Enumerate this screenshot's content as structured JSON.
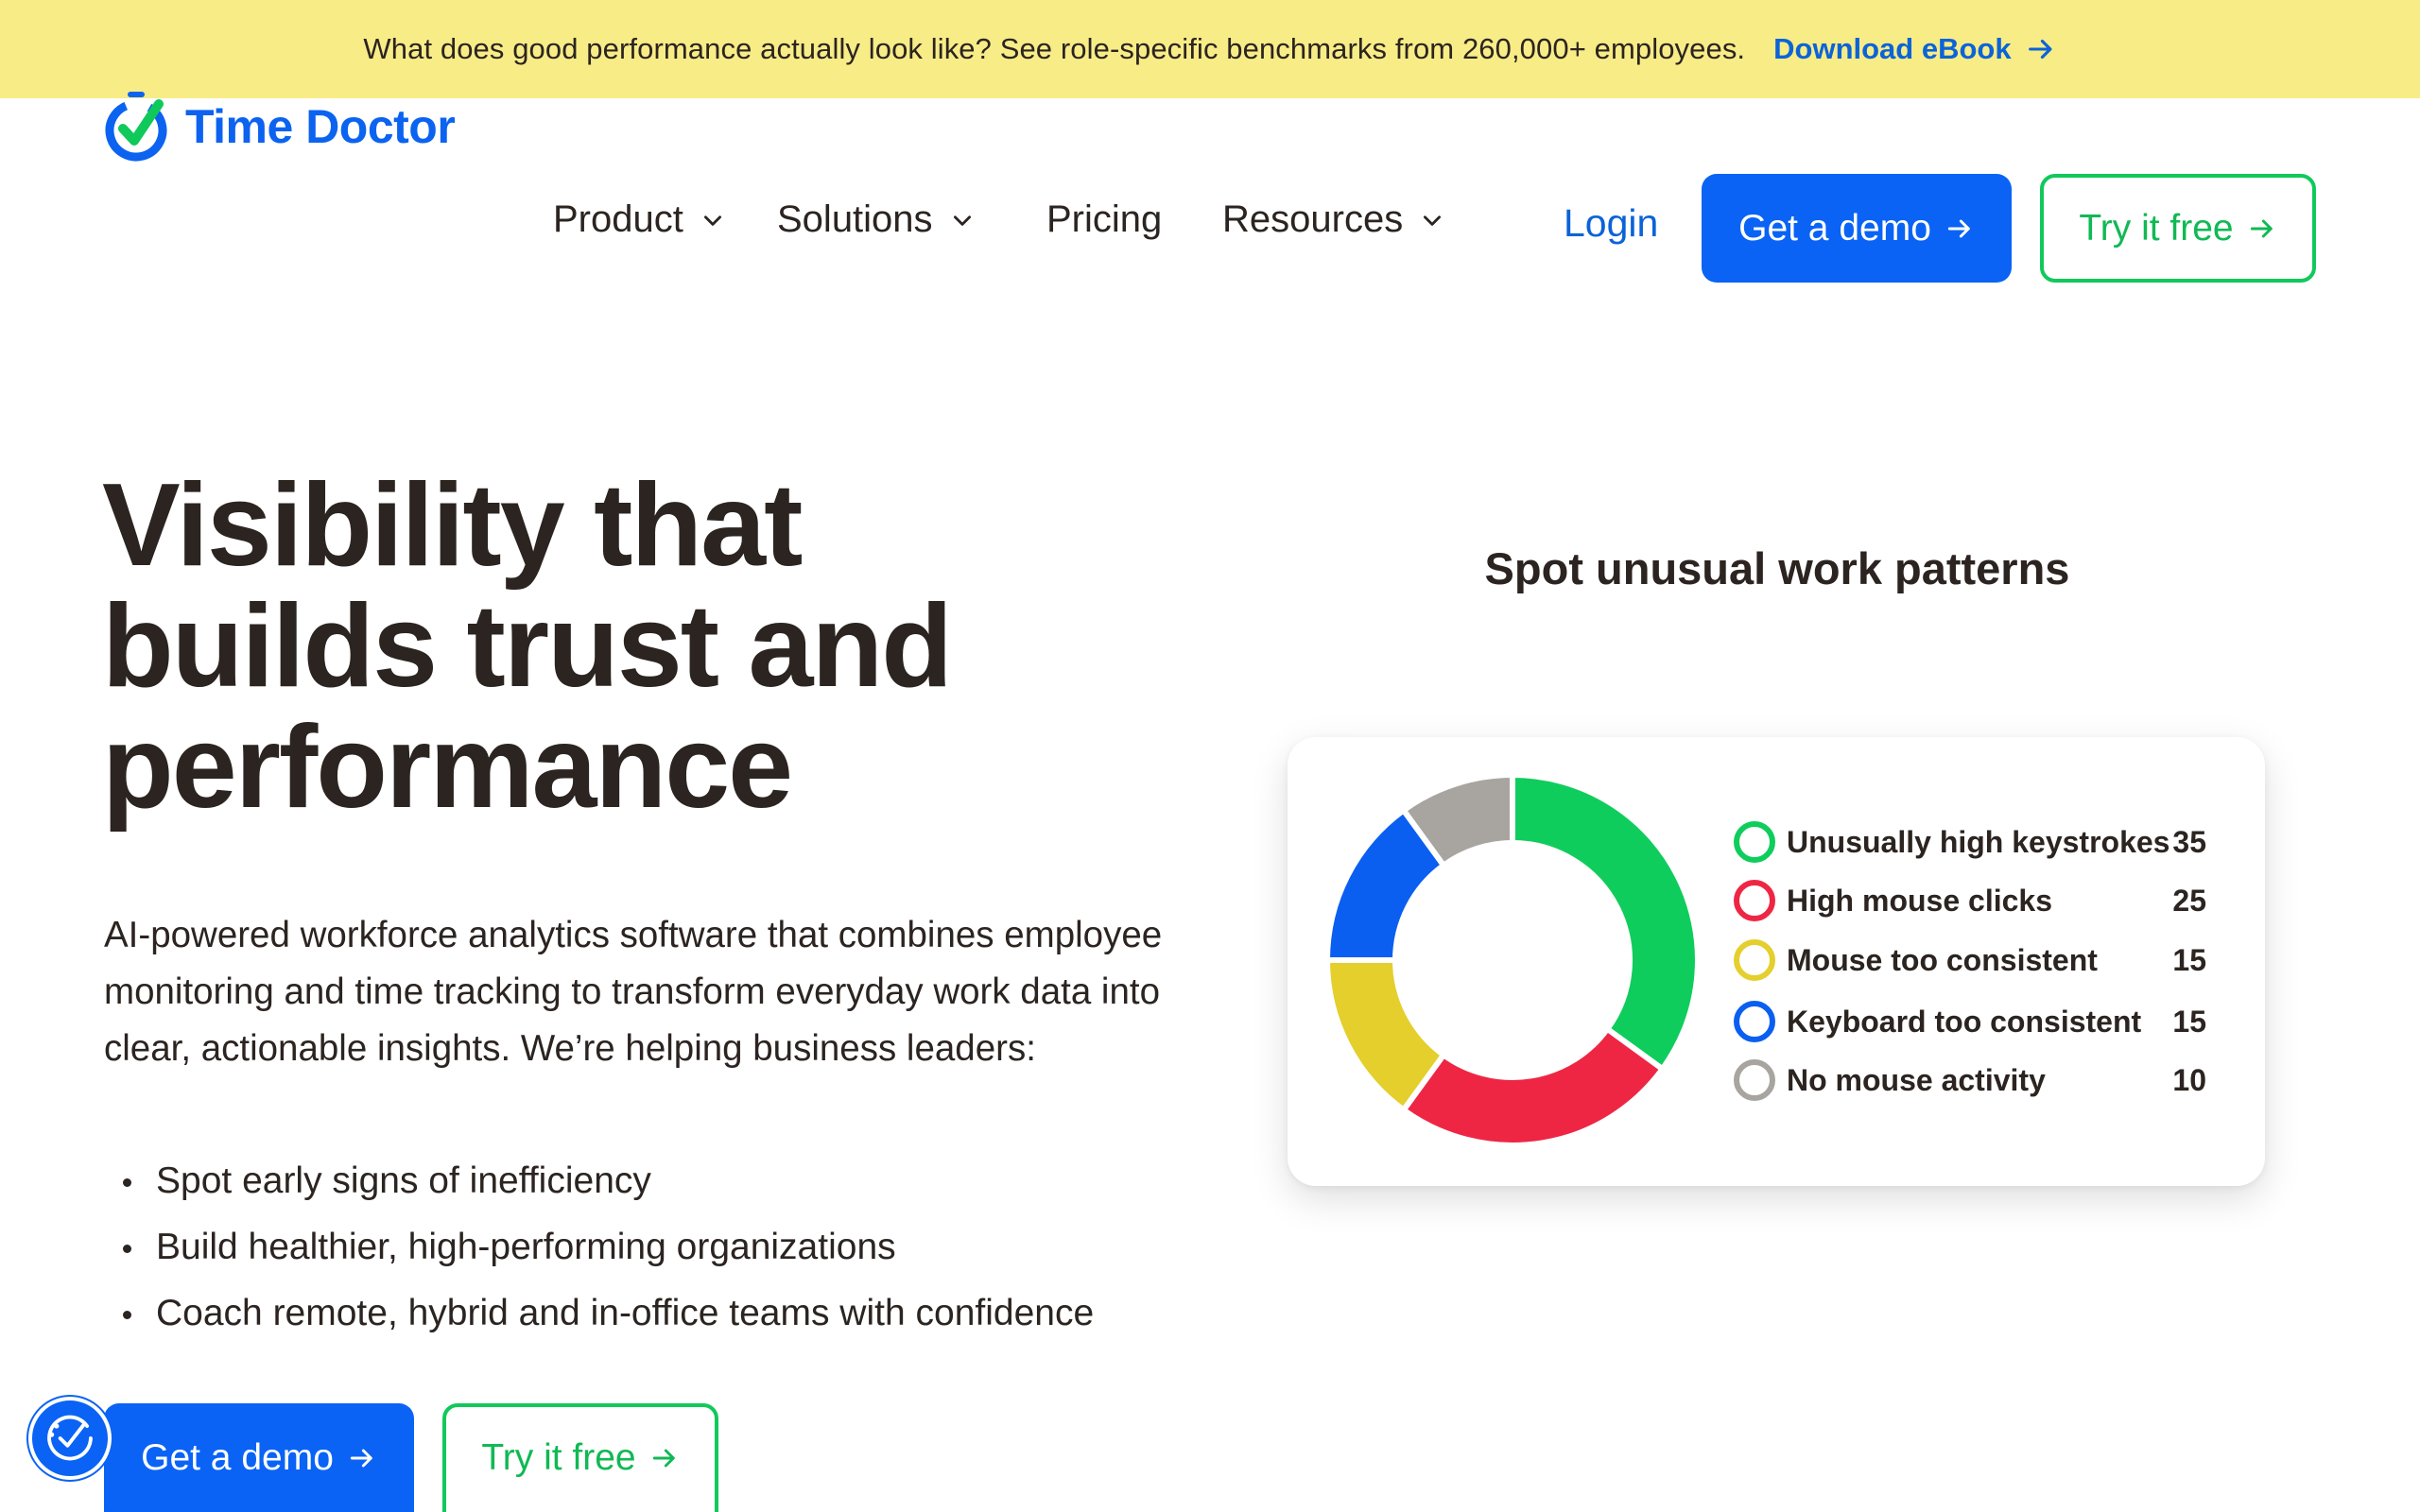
{
  "banner": {
    "text": "What does good performance actually look like? See role-specific benchmarks from 260,000+ employees.",
    "link": "Download eBook"
  },
  "header": {
    "logo_text": "Time Doctor",
    "nav": [
      {
        "label": "Product",
        "has_dropdown": true
      },
      {
        "label": "Solutions",
        "has_dropdown": true
      },
      {
        "label": "Pricing",
        "has_dropdown": false
      },
      {
        "label": "Resources",
        "has_dropdown": true
      }
    ],
    "login": "Login",
    "demo_button": "Get a demo",
    "try_button": "Try it free"
  },
  "hero": {
    "title_lines": [
      "Visibility that",
      "builds trust and",
      "performance"
    ],
    "description": "AI-powered workforce analytics software that combines employee monitoring and time tracking to transform everyday work data into clear, actionable insights. We’re helping business leaders:",
    "bullets": [
      "Spot early signs of inefficiency",
      "Build healthier, high-performing organizations",
      "Coach remote, hybrid and in-office teams with confidence"
    ],
    "demo_button": "Get a demo",
    "try_button": "Try it free"
  },
  "colors": {
    "brand_blue": "#0a63f5",
    "brand_green": "#10c95b",
    "banner_yellow": "#f8ec87",
    "text_dark": "#2b2420"
  },
  "chart_data": {
    "type": "pie",
    "variant": "donut",
    "title": "Spot unusual work patterns",
    "categories": [
      "Unusually high keystrokes",
      "High mouse clicks",
      "Mouse too consistent",
      "Keyboard too consistent",
      "No mouse activity"
    ],
    "values": [
      35,
      25,
      15,
      15,
      10
    ],
    "colors": [
      "#0fcd5c",
      "#ee2644",
      "#e4cf2c",
      "#0b5ff0",
      "#a8a4a0"
    ],
    "legend_placement": "right"
  },
  "accessibility_widget": {
    "icon": "accessibility-icon"
  }
}
